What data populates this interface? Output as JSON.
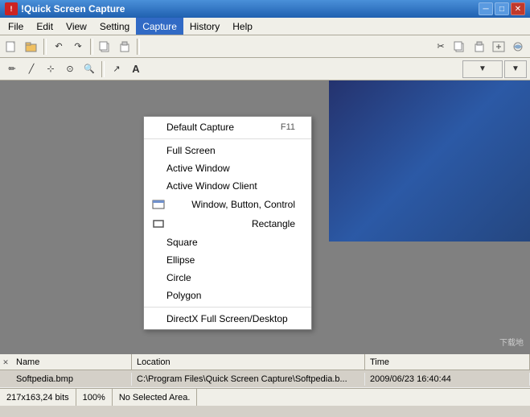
{
  "app": {
    "title": "!Quick Screen Capture",
    "icon": "QSC"
  },
  "title_buttons": {
    "minimize": "─",
    "maximize": "□",
    "close": "✕"
  },
  "menu_bar": {
    "items": [
      {
        "id": "file",
        "label": "File"
      },
      {
        "id": "edit",
        "label": "Edit"
      },
      {
        "id": "view",
        "label": "View"
      },
      {
        "id": "setting",
        "label": "Setting"
      },
      {
        "id": "capture",
        "label": "Capture",
        "active": true
      },
      {
        "id": "history",
        "label": "History"
      },
      {
        "id": "help",
        "label": "Help"
      }
    ]
  },
  "capture_menu": {
    "items": [
      {
        "id": "default-capture",
        "label": "Default Capture",
        "shortcut": "F11",
        "icon": false
      },
      {
        "id": "separator1",
        "type": "separator"
      },
      {
        "id": "full-screen",
        "label": "Full Screen",
        "shortcut": "",
        "icon": false
      },
      {
        "id": "active-window",
        "label": "Active Window",
        "shortcut": "",
        "icon": false
      },
      {
        "id": "active-window-client",
        "label": "Active Window Client",
        "shortcut": "",
        "icon": false
      },
      {
        "id": "window-button-control",
        "label": "Window, Button, Control",
        "shortcut": "",
        "icon": true
      },
      {
        "id": "rectangle",
        "label": "Rectangle",
        "shortcut": "",
        "icon": true
      },
      {
        "id": "square",
        "label": "Square",
        "shortcut": "",
        "icon": false
      },
      {
        "id": "ellipse",
        "label": "Ellipse",
        "shortcut": "",
        "icon": false
      },
      {
        "id": "circle",
        "label": "Circle",
        "shortcut": "",
        "icon": false
      },
      {
        "id": "polygon",
        "label": "Polygon",
        "shortcut": "",
        "icon": false
      },
      {
        "id": "separator2",
        "type": "separator"
      },
      {
        "id": "directx",
        "label": "DirectX Full Screen/Desktop",
        "shortcut": "",
        "icon": false
      }
    ]
  },
  "bottom_panel": {
    "columns": [
      {
        "id": "name",
        "label": "Name"
      },
      {
        "id": "location",
        "label": "Location"
      },
      {
        "id": "time",
        "label": "Time"
      }
    ],
    "rows": [
      {
        "name": "Softpedia.bmp",
        "location": "C:\\Program Files\\Quick Screen Capture\\Softpedia.b...",
        "time": "2009/06/23 16:40:44"
      }
    ]
  },
  "status_bar": {
    "dimensions": "217x163,24 bits",
    "zoom": "100%",
    "selection": "No Selected Area."
  },
  "watermark": "下载地"
}
